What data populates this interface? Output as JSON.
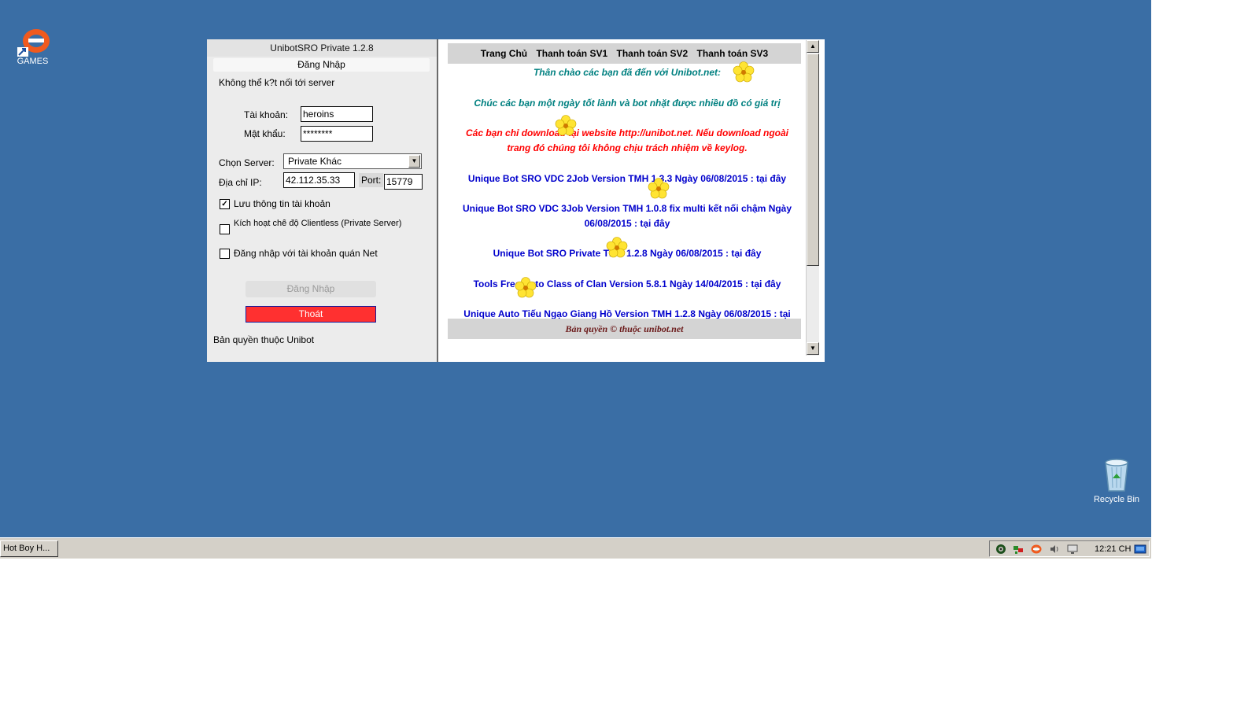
{
  "desktop": {
    "icons": [
      {
        "label": "GAMES"
      },
      {
        "label": "Recycle Bin"
      }
    ]
  },
  "taskbar": {
    "task_label": "Hot Boy H...",
    "clock": "12:21 CH",
    "tray_icons": [
      "gear-icon",
      "network-icon",
      "games-icon",
      "volume-icon",
      "monitor-icon",
      "show-desktop-icon"
    ]
  },
  "login_window": {
    "title": "UnibotSRO Private 1.2.8",
    "subtitle": "Đăng Nhập",
    "status": "Không thể k?t nối tới server",
    "account_label": "Tài khoản:",
    "account_value": "heroins",
    "password_label": "Mật khẩu:",
    "password_value": "********",
    "server_label": "Chọn Server:",
    "server_value": "Private Khác",
    "ip_label": "Địa chỉ IP:",
    "ip_value": "42.112.35.33",
    "port_label": "Port:",
    "port_value": "15779",
    "checkboxes": [
      {
        "label": "Lưu thông tin tài khoản",
        "checked": true
      },
      {
        "label": "Kích hoạt chế độ Clientless (Private Server)",
        "checked": false
      },
      {
        "label": "Đăng nhập với tài khoản quán Net",
        "checked": false
      }
    ],
    "login_button": "Đăng Nhập",
    "exit_button": "Thoát",
    "copyright": "Bản quyền thuộc Unibot"
  },
  "web_panel": {
    "nav": [
      "Trang Chủ",
      "Thanh toán SV1",
      "Thanh toán SV2",
      "Thanh toán SV3"
    ],
    "welcome": "Thân chào các bạn đã đến với Unibot.net:",
    "wish": "Chúc các bạn một ngày tốt lành và bot nhặt được nhiều đồ có giá trị",
    "warning": "Các bạn chỉ download tại website http://unibot.net. Nếu download ngoài trang đó chúng tôi không chịu trách nhiệm về keylog.",
    "links": [
      "Unique Bot SRO VDC 2Job Version TMH 1.3.3 Ngày 06/08/2015 : tại đây",
      "Unique Bot SRO VDC 3Job Version TMH 1.0.8 fix multi kết nối chậm Ngày 06/08/2015 : tại đây",
      "Unique Bot SRO Private TMH 1.2.8 Ngày 06/08/2015 : tại đây",
      "Tools Free Auto Class of Clan Version 5.8.1 Ngày 14/04/2015 : tại đây",
      "Unique Auto Tiếu Ngạo Giang Hồ Version TMH 1.2.8 Ngày 06/08/2015 : tại"
    ],
    "footer": "Bản quyền © thuộc unibot.net"
  }
}
